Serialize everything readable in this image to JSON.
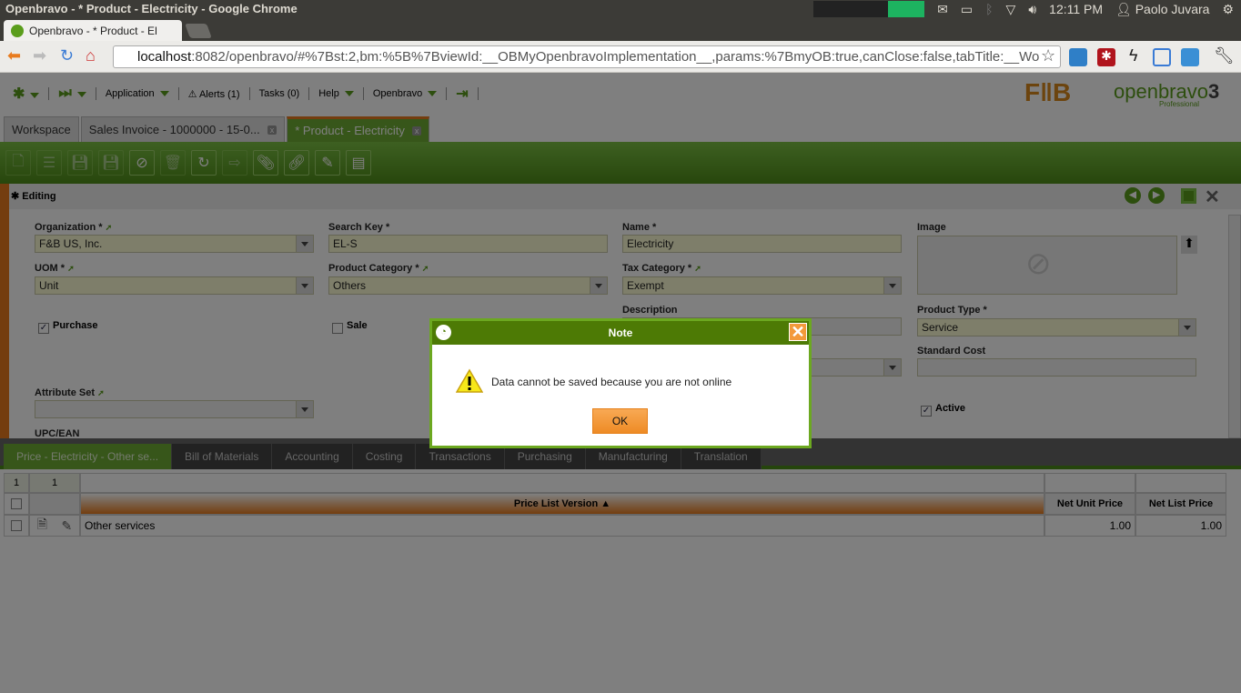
{
  "os": {
    "window_title": "Openbravo - * Product - Electricity - Google Chrome",
    "time": "12:11 PM",
    "user": "Paolo Juvara"
  },
  "browser": {
    "tab_title": "Openbravo - * Product - El",
    "url_host": "localhost",
    "url_rest": ":8082/openbravo/#%7Bst:2,bm:%5B%7BviewId:__OBMyOpenbravoImplementation__,params:%7BmyOB:true,canClose:false,tabTitle:__Wo"
  },
  "nav": {
    "application": "Application",
    "alerts": "Alerts (1)",
    "tasks": "Tasks (0)",
    "help": "Help",
    "openbravo": "Openbravo",
    "logo_fb": "F+B",
    "logo_ob": "openbravo",
    "logo_ob_sub": "Professional"
  },
  "main_tabs": [
    {
      "label": "Workspace"
    },
    {
      "label": "Sales Invoice - 1000000 - 15-0..."
    },
    {
      "label": "* Product - Electricity"
    }
  ],
  "editing_label": "Editing",
  "form": {
    "organization": {
      "label": "Organization *",
      "value": "F&B US, Inc."
    },
    "search_key": {
      "label": "Search Key *",
      "value": "EL-S"
    },
    "name": {
      "label": "Name *",
      "value": "Electricity"
    },
    "image": {
      "label": "Image"
    },
    "uom": {
      "label": "UOM *",
      "value": "Unit"
    },
    "product_category": {
      "label": "Product Category *",
      "value": "Others"
    },
    "tax_category": {
      "label": "Tax Category *",
      "value": "Exempt"
    },
    "description": {
      "label": "Description",
      "value": ""
    },
    "product_type": {
      "label": "Product Type *",
      "value": "Service"
    },
    "standard_cost": {
      "label": "Standard Cost",
      "value": ""
    },
    "purchase": {
      "label": "Purchase",
      "checked": true
    },
    "sale": {
      "label": "Sale",
      "checked": false
    },
    "active": {
      "label": "Active",
      "checked": true
    },
    "attribute_set": {
      "label": "Attribute Set",
      "value": ""
    },
    "upc": {
      "label": "UPC/EAN"
    }
  },
  "sub_tabs": [
    "Price - Electricity - Other se...",
    "Bill of Materials",
    "Accounting",
    "Costing",
    "Transactions",
    "Purchasing",
    "Manufacturing",
    "Translation"
  ],
  "grid": {
    "counts": [
      "1",
      "1"
    ],
    "columns": [
      "Price List Version ▲",
      "Net Unit Price",
      "Net List Price"
    ],
    "rows": [
      {
        "price_list_version": "Other services",
        "net_unit_price": "1.00",
        "net_list_price": "1.00"
      }
    ]
  },
  "dialog": {
    "title": "Note",
    "message": "Data cannot be saved because you are not online",
    "ok": "OK"
  }
}
